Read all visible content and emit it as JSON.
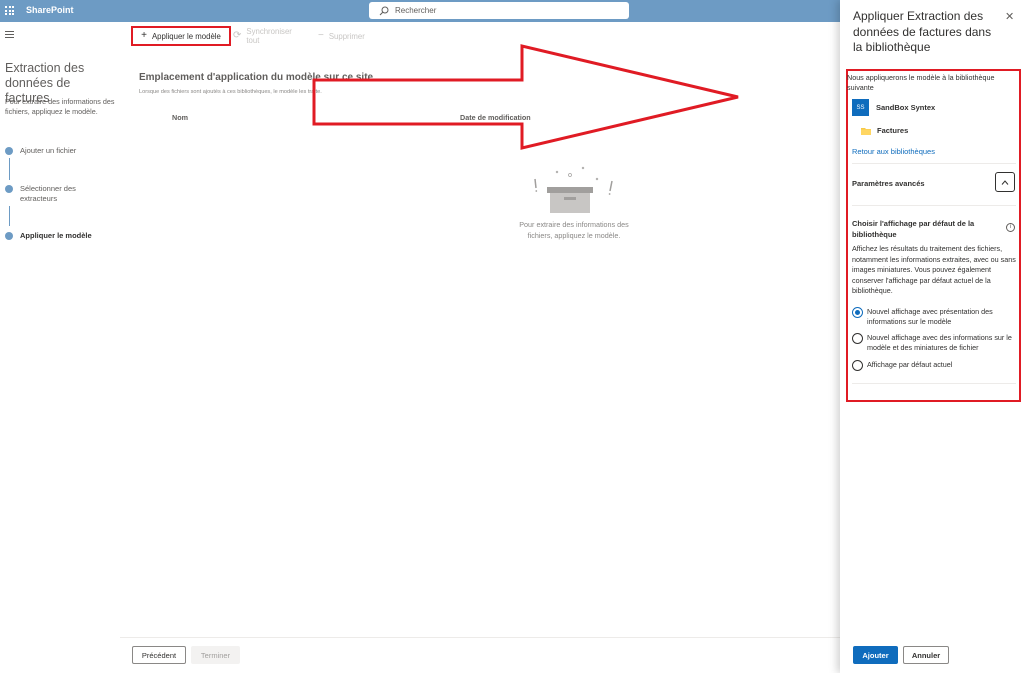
{
  "suite_bar": {
    "app_name": "SharePoint",
    "search_placeholder": "Rechercher",
    "background_color": "#6d9bc4",
    "icons": [
      "waffle-icon",
      "search-icon"
    ]
  },
  "left_pane": {
    "title": "Extraction des données de factures",
    "description": "Pour extraire des informations des fichiers, appliquez le modèle.",
    "steps": [
      {
        "label": "Ajouter un fichier",
        "active": false
      },
      {
        "label": "Sélectionner des extracteurs",
        "active": false
      },
      {
        "label": "Appliquer le modèle",
        "active": true
      }
    ]
  },
  "command_bar": {
    "apply_label": "Appliquer le modèle",
    "sync_label": "Synchroniser tout",
    "delete_label": "Supprimer"
  },
  "main": {
    "title": "Emplacement d'application du modèle sur ce site",
    "subtitle": "Lorsque des fichiers sont ajoutés à ces bibliothèques, le modèle les traite.",
    "columns": [
      "Nom",
      "Date de modification"
    ],
    "empty_message": "Pour extraire des informations des fichiers, appliquez le modèle."
  },
  "footer": {
    "previous_label": "Précédent",
    "finish_label": "Terminer"
  },
  "panel": {
    "title": "Appliquer Extraction des données de factures dans la bibliothèque",
    "intro": "Nous appliquerons le modèle à la bibliothèque suivante",
    "site_initials": "SS",
    "site_name": "SandBox Syntex",
    "library_name": "Factures",
    "back_link": "Retour aux bibliothèques",
    "advanced_label": "Paramètres avancés",
    "view_title": "Choisir l'affichage par défaut de la bibliothèque",
    "view_description": "Affichez les résultats du traitement des fichiers, notamment les informations extraites, avec ou sans images miniatures. Vous pouvez également conserver l'affichage par défaut actuel de la bibliothèque.",
    "options": [
      {
        "label": "Nouvel affichage avec présentation des informations sur le modèle",
        "selected": true
      },
      {
        "label": "Nouvel affichage avec des informations sur le modèle et des miniatures de fichier",
        "selected": false
      },
      {
        "label": "Affichage par défaut actuel",
        "selected": false
      }
    ],
    "add_label": "Ajouter",
    "cancel_label": "Annuler"
  },
  "colors": {
    "accent": "#0f6cbd",
    "highlight": "#e01b24"
  }
}
